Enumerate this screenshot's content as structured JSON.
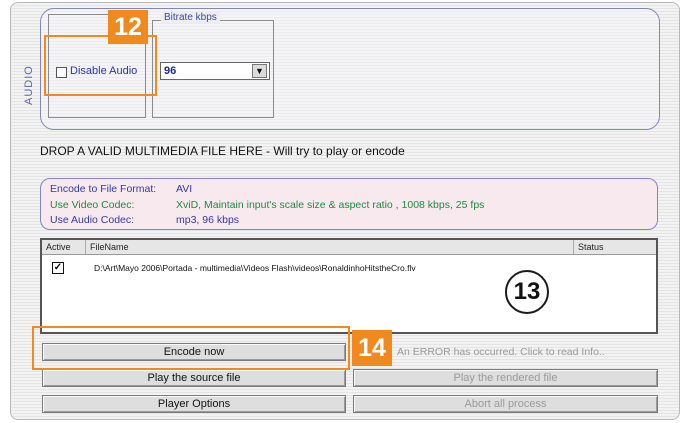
{
  "audio": {
    "section_label": "AUDIO",
    "disable_audio_label": "Disable Audio",
    "disable_audio_checked": false,
    "bitrate_title": "Bitrate  kbps",
    "bitrate_value": "96",
    "dropdown_arrow": "▼"
  },
  "callouts": {
    "c12": "12",
    "c13": "13",
    "c14": "14",
    "highlight_color": "#f08a1e"
  },
  "drop_zone": {
    "text": "DROP A VALID MULTIMEDIA FILE HERE - Will try to play or encode"
  },
  "encode_info": {
    "format_label": "Encode to File Format:",
    "format_value": "AVI",
    "video_label": "Use Video Codec:",
    "video_value": "XviD,  Maintain input's scale size & aspect ratio ,  1008 kbps,  25 fps",
    "audio_label": "Use Audio Codec:",
    "audio_value": "mp3,  96 kbps"
  },
  "file_table": {
    "columns": [
      "Active",
      "FileName",
      "Status"
    ],
    "rows": [
      {
        "active_mark": "✓",
        "file": "D:\\Art\\Mayo 2006\\Portada - multimedia\\Videos Flash\\videos\\RonaldinhoHitstheCro.flv",
        "status": ""
      }
    ]
  },
  "buttons": {
    "encode_now": "Encode now",
    "play_source": "Play the source file",
    "play_rendered": "Play the rendered file",
    "player_options": "Player Options",
    "abort_all": "Abort all process"
  },
  "status": {
    "error_text": "An ERROR has occurred. Click to read Info.."
  }
}
